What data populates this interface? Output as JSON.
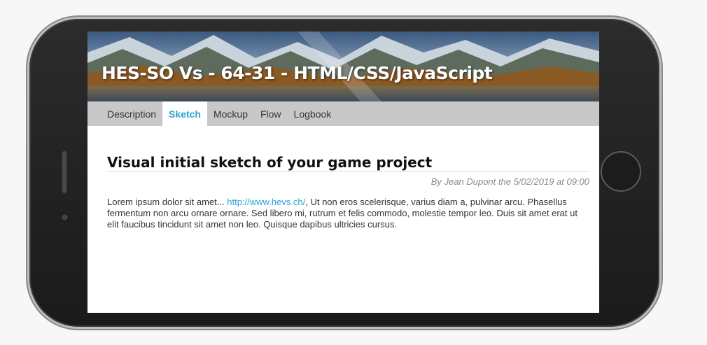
{
  "banner": {
    "title": "HES-SO Vs - 64-31 - HTML/CSS/JavaScript"
  },
  "nav": {
    "tabs": [
      {
        "label": "Description"
      },
      {
        "label": "Sketch"
      },
      {
        "label": "Mockup"
      },
      {
        "label": "Flow"
      },
      {
        "label": "Logbook"
      }
    ],
    "active": "Sketch"
  },
  "article": {
    "title": "Visual initial sketch of your game project",
    "byline": "By Jean Dupont the 5/02/2019 at 09:00",
    "body_before_link": "Lorem ipsum dolor sit amet... ",
    "link_text": "http://www.hevs.ch/",
    "body_after_link": ", Ut non eros scelerisque, varius diam a, pulvinar arcu. Phasellus fermentum non arcu ornare ornare. Sed libero mi, rutrum et felis commodo, molestie tempor leo. Duis sit amet erat ut elit faucibus tincidunt sit amet non leo. Quisque dapibus ultricies cursus."
  },
  "colors": {
    "accent": "#2aa6d6",
    "nav_bg": "#c8c8c8",
    "phone_body": "#1a1a1a"
  }
}
